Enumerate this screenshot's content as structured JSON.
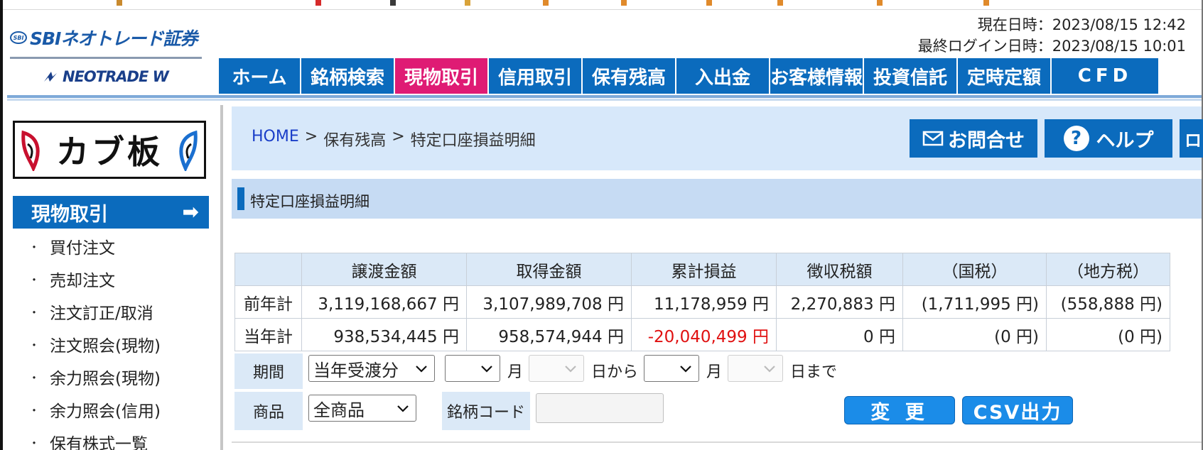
{
  "header": {
    "brand_sbi": "SBIネオトレード証券",
    "brand_sbi_mark": "SBI",
    "brand_neo": "NEOTRADE W",
    "current_time_label": "現在日時：2023/08/15 12:42",
    "last_login_label": "最終ログイン日時：2023/08/15 10:01"
  },
  "gnav": [
    {
      "label": "ホーム",
      "active": false
    },
    {
      "label": "銘柄検索",
      "active": false
    },
    {
      "label": "現物取引",
      "active": true
    },
    {
      "label": "信用取引",
      "active": false
    },
    {
      "label": "保有残高",
      "active": false
    },
    {
      "label": "入出金",
      "active": false
    },
    {
      "label": "お客様情報",
      "active": false
    },
    {
      "label": "投資信託",
      "active": false
    },
    {
      "label": "定時定額",
      "active": false
    },
    {
      "label": "CFD",
      "active": false
    }
  ],
  "sidebar": {
    "banner": "カブ板",
    "heading": "現物取引",
    "heading_arrow": "➡",
    "items": [
      {
        "label": "買付注文"
      },
      {
        "label": "売却注文"
      },
      {
        "label": "注文訂正/取消"
      },
      {
        "label": "注文照会(現物)"
      },
      {
        "label": "余力照会(現物)"
      },
      {
        "label": "余力照会(信用)"
      },
      {
        "label": "保有株式一覧"
      }
    ],
    "bullet": "・"
  },
  "breadcrumb": {
    "home": "HOME",
    "sep": ">",
    "level1": "保有残高",
    "level2": "特定口座損益明細"
  },
  "top_buttons": {
    "inquiry": "お問合せ",
    "help": "ヘルプ",
    "help_mark": "?",
    "cut": "ロ"
  },
  "section_title": "特定口座損益明細",
  "pl_table": {
    "columns": [
      "",
      "譲渡金額",
      "取得金額",
      "累計損益",
      "徴収税額",
      "（国税）",
      "（地方税）"
    ],
    "rows": [
      {
        "label": "前年計",
        "cells": [
          "3,119,168,667 円",
          "3,107,989,708 円",
          "11,178,959 円",
          "2,270,883 円",
          "(1,711,995 円)",
          "(558,888 円)"
        ]
      },
      {
        "label": "当年計",
        "cells": [
          "938,534,445 円",
          "958,574,944 円",
          "-20,040,499 円",
          "0 円",
          "(0 円)",
          "(0 円)"
        ]
      }
    ]
  },
  "filter": {
    "period_label": "期間",
    "period_value": "当年受渡分",
    "month_text_1": "月",
    "day_from_text": "日から",
    "month_text_2": "月",
    "day_to_text": "日まで",
    "product_label": "商品",
    "product_value": "全商品",
    "code_label": "銘柄コード",
    "change_button": "変 更",
    "csv_button": "CSV出力"
  },
  "colors": {
    "nav_blue": "#0b6bbd",
    "nav_active": "#df1b74",
    "negative": "#e01010",
    "link": "#1a3ec8"
  }
}
